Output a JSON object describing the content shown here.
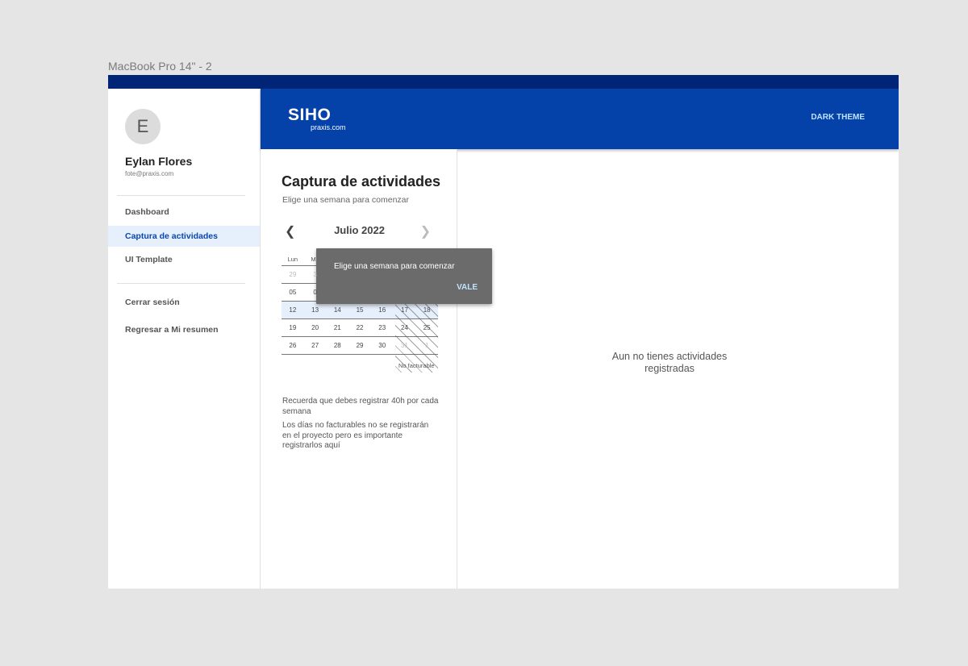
{
  "frame": {
    "label": "MacBook Pro 14\" - 2"
  },
  "user": {
    "initial": "E",
    "name": "Eylan Flores",
    "email": "fote@praxis.com"
  },
  "sidebar": {
    "items": [
      {
        "label": "Dashboard"
      },
      {
        "label": "Captura de actividades"
      },
      {
        "label": "UI Template"
      },
      {
        "label": "Cerrar sesión"
      },
      {
        "label": "Regresar a Mi resumen"
      }
    ],
    "active_index": 1
  },
  "header": {
    "logo": "SIHO",
    "logo_sub": "praxis.com",
    "theme_button": "DARK THEME"
  },
  "capture": {
    "title": "Captura de actividades",
    "subtitle": "Elige una semana para comenzar",
    "month": "Julio 2022",
    "prev_icon": "chevron-left-icon",
    "next_icon": "chevron-right-icon",
    "weekday_headers": [
      "Lun",
      "Ma",
      "",
      "",
      "",
      "",
      ""
    ],
    "weeks": [
      [
        "29",
        "3",
        "",
        "",
        "",
        "",
        ""
      ],
      [
        "05",
        "0",
        "",
        "",
        "",
        "",
        ""
      ],
      [
        "12",
        "13",
        "14",
        "15",
        "16",
        "17",
        "18"
      ],
      [
        "19",
        "20",
        "21",
        "22",
        "23",
        "24",
        "25"
      ],
      [
        "26",
        "27",
        "28",
        "29",
        "30",
        "31",
        "1"
      ]
    ],
    "selected_week_index": 2,
    "legend": "No facturable",
    "note1": "Recuerda que debes registrar 40h por cada semana",
    "note2": "Los días no facturables no se registrarán en el proyecto pero es importante registrarlos aquí"
  },
  "empty_state": {
    "text": "Aun no tienes actividades registradas"
  },
  "toast": {
    "message": "Elige una semana para comenzar",
    "action": "VALE"
  },
  "colors": {
    "header": "#0441a8",
    "top_strip": "#002576",
    "active_nav_bg": "#e6effc",
    "active_nav_text": "#0a46b0",
    "toast_bg": "#6b6b6b",
    "toast_action": "#bfe3ff"
  }
}
